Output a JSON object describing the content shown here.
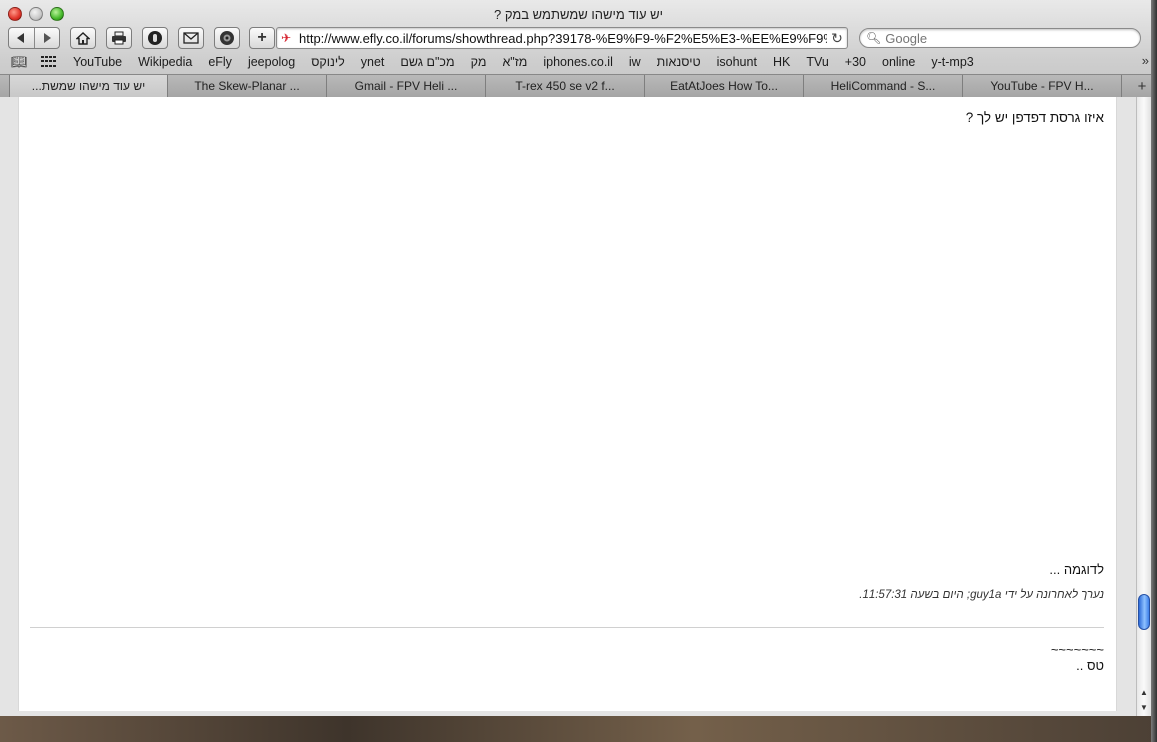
{
  "window": {
    "title": "יש עוד מישהו שמשתמש במק ?"
  },
  "toolbar": {
    "url": "http://www.efly.co.il/forums/showthread.php?39178-%E9%F9-%F2%E5%E3-%EE%E9%F9%E",
    "search_placeholder": "Google"
  },
  "bookmarks": {
    "items": [
      "YouTube",
      "Wikipedia",
      "eFly",
      "jeepolog",
      "לינוקס",
      "ynet",
      "מכ\"ם גשם",
      "מק",
      "מז\"א",
      "iphones.co.il",
      "iw",
      "טיסנאות",
      "isohunt",
      "HK",
      "TVu",
      "+30",
      "online",
      "y-t-mp3"
    ]
  },
  "tabs": [
    {
      "label": "יש עוד מישהו שמשת...",
      "active": true
    },
    {
      "label": "The Skew-Planar ...",
      "active": false
    },
    {
      "label": "Gmail - FPV Heli ...",
      "active": false
    },
    {
      "label": "T-rex 450 se v2 f...",
      "active": false
    },
    {
      "label": "EatAtJoes How To...",
      "active": false
    },
    {
      "label": "HeliCommand - S...",
      "active": false
    },
    {
      "label": "YouTube - FPV H...",
      "active": false
    }
  ],
  "post": {
    "question": "איזו גרסת דפדפן יש לך ?",
    "example": "לדוגמה ...",
    "edit_note": "נערך לאחרונה על ידי guy1a; היום בשעה 11:57:31.",
    "signature_line1": "~~~~~~~",
    "signature_line2": "טס .."
  },
  "colors": {
    "scroll_thumb": "#3d7ee8",
    "close_button": "#e0342a",
    "zoom_button": "#45b82a"
  }
}
